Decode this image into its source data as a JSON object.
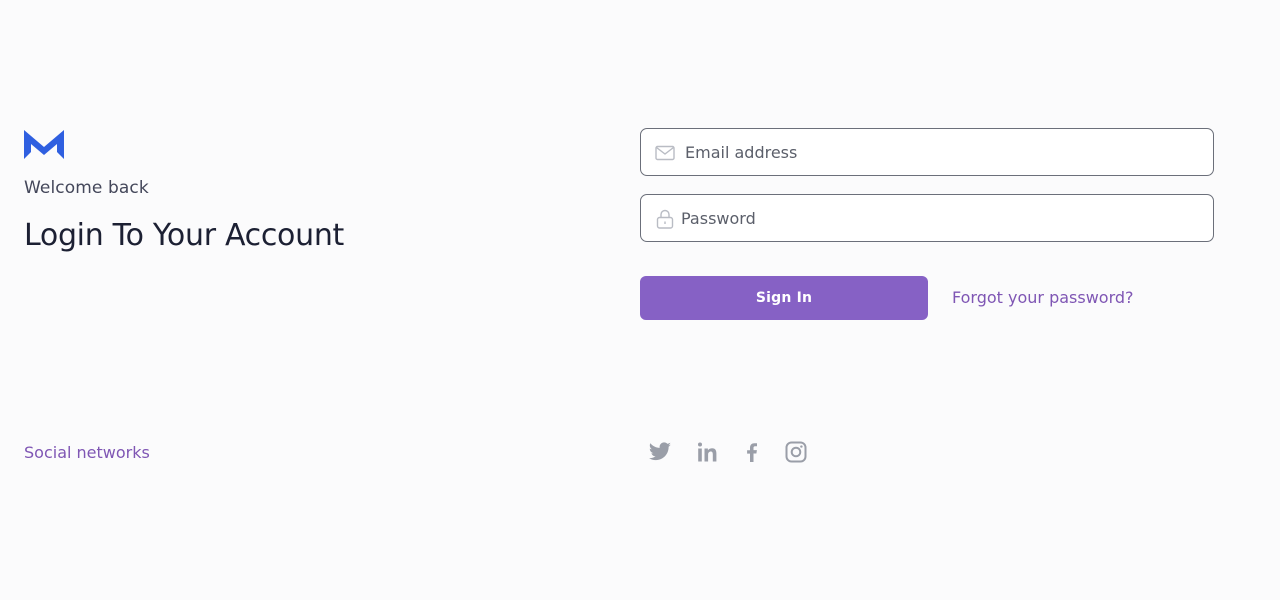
{
  "brand": {
    "logo_icon": "m-logo-icon",
    "logo_color": "#2f5fe0"
  },
  "header": {
    "welcome": "Welcome back",
    "title": "Login To Your Account"
  },
  "form": {
    "email": {
      "placeholder": "Email address",
      "value": "",
      "icon": "mail-icon"
    },
    "password": {
      "placeholder": "Password",
      "value": "",
      "icon": "lock-icon"
    },
    "signin_label": "Sign In",
    "forgot_label": "Forgot your password?"
  },
  "social": {
    "label": "Social networks",
    "items": [
      {
        "icon": "twitter-icon"
      },
      {
        "icon": "linkedin-icon"
      },
      {
        "icon": "facebook-icon"
      },
      {
        "icon": "instagram-icon"
      }
    ]
  },
  "colors": {
    "accent": "#8661c5",
    "link": "#7f56b4",
    "icon_gray": "#9a9ea8",
    "background": "#fbfbfc"
  }
}
